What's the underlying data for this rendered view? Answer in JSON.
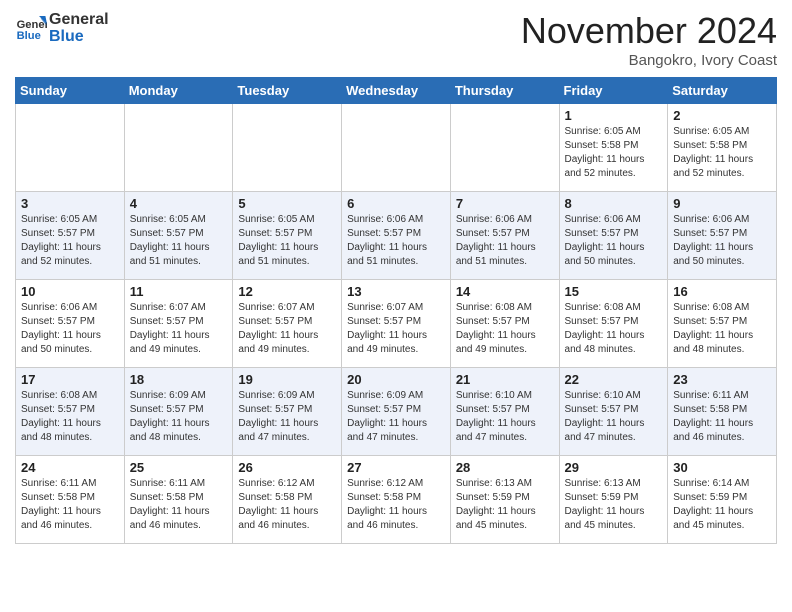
{
  "header": {
    "logo_line1": "General",
    "logo_line2": "Blue",
    "month": "November 2024",
    "location": "Bangokro, Ivory Coast"
  },
  "weekdays": [
    "Sunday",
    "Monday",
    "Tuesday",
    "Wednesday",
    "Thursday",
    "Friday",
    "Saturday"
  ],
  "weeks": [
    [
      {
        "day": "",
        "info": ""
      },
      {
        "day": "",
        "info": ""
      },
      {
        "day": "",
        "info": ""
      },
      {
        "day": "",
        "info": ""
      },
      {
        "day": "",
        "info": ""
      },
      {
        "day": "1",
        "info": "Sunrise: 6:05 AM\nSunset: 5:58 PM\nDaylight: 11 hours\nand 52 minutes."
      },
      {
        "day": "2",
        "info": "Sunrise: 6:05 AM\nSunset: 5:58 PM\nDaylight: 11 hours\nand 52 minutes."
      }
    ],
    [
      {
        "day": "3",
        "info": "Sunrise: 6:05 AM\nSunset: 5:57 PM\nDaylight: 11 hours\nand 52 minutes."
      },
      {
        "day": "4",
        "info": "Sunrise: 6:05 AM\nSunset: 5:57 PM\nDaylight: 11 hours\nand 51 minutes."
      },
      {
        "day": "5",
        "info": "Sunrise: 6:05 AM\nSunset: 5:57 PM\nDaylight: 11 hours\nand 51 minutes."
      },
      {
        "day": "6",
        "info": "Sunrise: 6:06 AM\nSunset: 5:57 PM\nDaylight: 11 hours\nand 51 minutes."
      },
      {
        "day": "7",
        "info": "Sunrise: 6:06 AM\nSunset: 5:57 PM\nDaylight: 11 hours\nand 51 minutes."
      },
      {
        "day": "8",
        "info": "Sunrise: 6:06 AM\nSunset: 5:57 PM\nDaylight: 11 hours\nand 50 minutes."
      },
      {
        "day": "9",
        "info": "Sunrise: 6:06 AM\nSunset: 5:57 PM\nDaylight: 11 hours\nand 50 minutes."
      }
    ],
    [
      {
        "day": "10",
        "info": "Sunrise: 6:06 AM\nSunset: 5:57 PM\nDaylight: 11 hours\nand 50 minutes."
      },
      {
        "day": "11",
        "info": "Sunrise: 6:07 AM\nSunset: 5:57 PM\nDaylight: 11 hours\nand 49 minutes."
      },
      {
        "day": "12",
        "info": "Sunrise: 6:07 AM\nSunset: 5:57 PM\nDaylight: 11 hours\nand 49 minutes."
      },
      {
        "day": "13",
        "info": "Sunrise: 6:07 AM\nSunset: 5:57 PM\nDaylight: 11 hours\nand 49 minutes."
      },
      {
        "day": "14",
        "info": "Sunrise: 6:08 AM\nSunset: 5:57 PM\nDaylight: 11 hours\nand 49 minutes."
      },
      {
        "day": "15",
        "info": "Sunrise: 6:08 AM\nSunset: 5:57 PM\nDaylight: 11 hours\nand 48 minutes."
      },
      {
        "day": "16",
        "info": "Sunrise: 6:08 AM\nSunset: 5:57 PM\nDaylight: 11 hours\nand 48 minutes."
      }
    ],
    [
      {
        "day": "17",
        "info": "Sunrise: 6:08 AM\nSunset: 5:57 PM\nDaylight: 11 hours\nand 48 minutes."
      },
      {
        "day": "18",
        "info": "Sunrise: 6:09 AM\nSunset: 5:57 PM\nDaylight: 11 hours\nand 48 minutes."
      },
      {
        "day": "19",
        "info": "Sunrise: 6:09 AM\nSunset: 5:57 PM\nDaylight: 11 hours\nand 47 minutes."
      },
      {
        "day": "20",
        "info": "Sunrise: 6:09 AM\nSunset: 5:57 PM\nDaylight: 11 hours\nand 47 minutes."
      },
      {
        "day": "21",
        "info": "Sunrise: 6:10 AM\nSunset: 5:57 PM\nDaylight: 11 hours\nand 47 minutes."
      },
      {
        "day": "22",
        "info": "Sunrise: 6:10 AM\nSunset: 5:57 PM\nDaylight: 11 hours\nand 47 minutes."
      },
      {
        "day": "23",
        "info": "Sunrise: 6:11 AM\nSunset: 5:58 PM\nDaylight: 11 hours\nand 46 minutes."
      }
    ],
    [
      {
        "day": "24",
        "info": "Sunrise: 6:11 AM\nSunset: 5:58 PM\nDaylight: 11 hours\nand 46 minutes."
      },
      {
        "day": "25",
        "info": "Sunrise: 6:11 AM\nSunset: 5:58 PM\nDaylight: 11 hours\nand 46 minutes."
      },
      {
        "day": "26",
        "info": "Sunrise: 6:12 AM\nSunset: 5:58 PM\nDaylight: 11 hours\nand 46 minutes."
      },
      {
        "day": "27",
        "info": "Sunrise: 6:12 AM\nSunset: 5:58 PM\nDaylight: 11 hours\nand 46 minutes."
      },
      {
        "day": "28",
        "info": "Sunrise: 6:13 AM\nSunset: 5:59 PM\nDaylight: 11 hours\nand 45 minutes."
      },
      {
        "day": "29",
        "info": "Sunrise: 6:13 AM\nSunset: 5:59 PM\nDaylight: 11 hours\nand 45 minutes."
      },
      {
        "day": "30",
        "info": "Sunrise: 6:14 AM\nSunset: 5:59 PM\nDaylight: 11 hours\nand 45 minutes."
      }
    ]
  ]
}
